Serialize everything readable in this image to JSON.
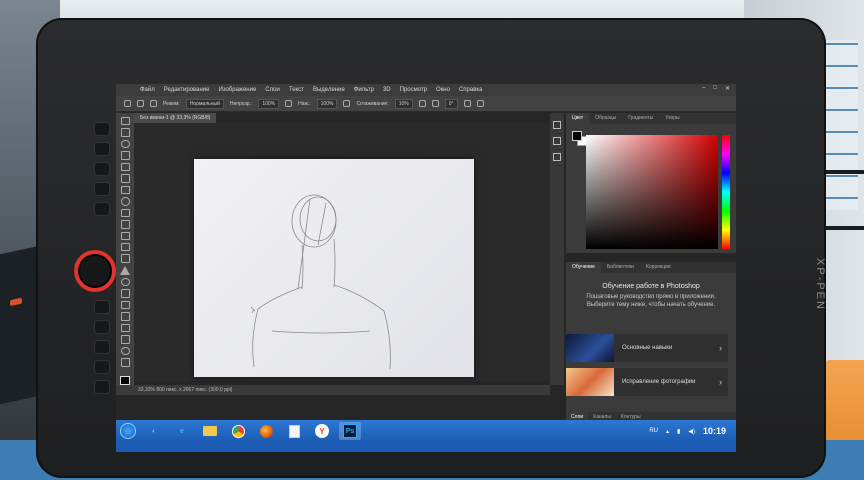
{
  "device": {
    "brand": "XP-PEN"
  },
  "menubar": {
    "items": [
      "Файл",
      "Редактирование",
      "Изображение",
      "Слои",
      "Текст",
      "Выделение",
      "Фильтр",
      "3D",
      "Просмотр",
      "Окно",
      "Справка"
    ]
  },
  "options": {
    "mode_label": "Режим:",
    "mode_value": "Нормальный",
    "opacity_label": "Непрозр.:",
    "opacity_value": "100%",
    "flow_label": "Наж.:",
    "flow_value": "100%",
    "smoothing_label": "Сглаживание:",
    "smoothing_value": "10%",
    "angle_value": "0°"
  },
  "document": {
    "tab_title": "Без имени-1 @ 33,3% (RGB/8)"
  },
  "status": {
    "text": "33,33%   800 пикс. x 2667 пикс. (300,0 ppi)"
  },
  "panels": {
    "color_tabs": [
      "Цвет",
      "Образцы",
      "Градиенты",
      "Узоры"
    ],
    "learn_tabs": [
      "Обучение",
      "Библиотеки",
      "Коррекция"
    ],
    "bottom_tabs": [
      "Слои",
      "Каналы",
      "Контуры"
    ],
    "foreground": "#000000",
    "background": "#ffffff"
  },
  "learn": {
    "title": "Обучение работе в Photoshop",
    "description": "Пошаговые руководство прямо в приложении. Выберите тему ниже, чтобы начать обучение.",
    "cards": [
      {
        "label": "Основные навыки"
      },
      {
        "label": "Исправление фотографии"
      }
    ]
  },
  "taskbar": {
    "apps": [
      "edge",
      "explorer",
      "chrome",
      "firefox",
      "files",
      "yandex",
      "photoshop"
    ],
    "photoshop_label": "Ps",
    "lang": "RU",
    "clock": "10:19"
  },
  "colors": {
    "taskbar": "#1b5bb3",
    "ps_accent": "#31a8ff",
    "bezel_ring": "#e2332c"
  }
}
